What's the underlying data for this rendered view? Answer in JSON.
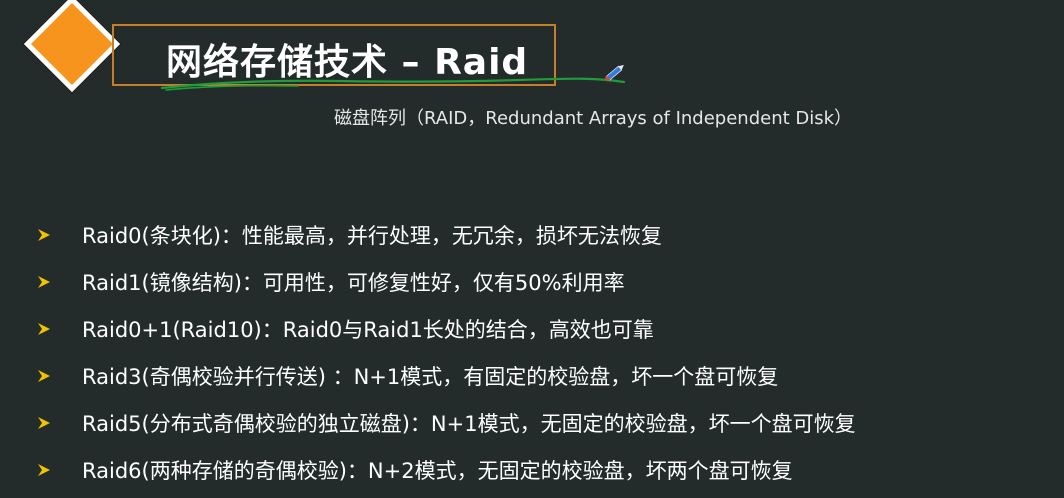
{
  "colors": {
    "background": "#232b2b",
    "accent_orange": "#f7941d",
    "frame_orange": "#c67e2b",
    "ink_green": "#1f9d3a",
    "bullet_yellow": "#f2c200",
    "text": "#ffffff"
  },
  "header": {
    "logo_icon": "orange-diamond-icon",
    "title": "网络存储技术 – Raid",
    "annotation_icon": "pen-icon"
  },
  "subtitle": "磁盘阵列（RAID，Redundant Arrays of Independent Disk）",
  "bullets": [
    {
      "icon": "arrow-bullet-icon",
      "text": "Raid0(条块化)：性能最高，并行处理，无冗余，损坏无法恢复"
    },
    {
      "icon": "arrow-bullet-icon",
      "text": "Raid1(镜像结构)：可用性，可修复性好，仅有50%利用率"
    },
    {
      "icon": "arrow-bullet-icon",
      "text": "Raid0+1(Raid10)：Raid0与Raid1长处的结合，高效也可靠"
    },
    {
      "icon": "arrow-bullet-icon",
      "text": "Raid3(奇偶校验并行传送) ：N+1模式，有固定的校验盘，坏一个盘可恢复"
    },
    {
      "icon": "arrow-bullet-icon",
      "text": "Raid5(分布式奇偶校验的独立磁盘)：N+1模式，无固定的校验盘，坏一个盘可恢复"
    },
    {
      "icon": "arrow-bullet-icon",
      "text": "Raid6(两种存储的奇偶校验)：N+2模式，无固定的校验盘，坏两个盘可恢复"
    }
  ]
}
